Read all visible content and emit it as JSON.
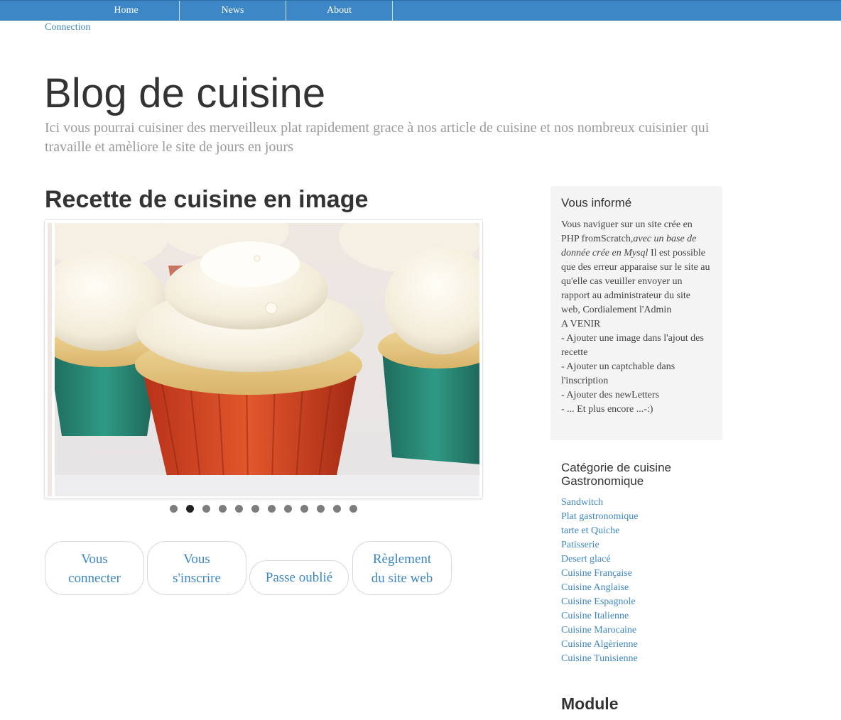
{
  "nav": {
    "home": "Home",
    "news": "News",
    "about": "About",
    "connection": "Connection"
  },
  "header": {
    "title": "Blog de cuisine",
    "subtitle": "Ici vous pourrai cuisiner des merveilleux plat rapidement grace à nos article de cuisine et nos nombreux cuisinier qui travaille et amèliore le site de jours en jours"
  },
  "main": {
    "section_title": "Recette de cuisine en image",
    "carousel": {
      "slide_count": 12,
      "active_index": 1
    },
    "buttons": {
      "login": [
        "Vous",
        "connecter"
      ],
      "register": [
        "Vous",
        "s'inscrire"
      ],
      "forgot": "Passe oublié",
      "rules": [
        "Règlement",
        "du site web"
      ]
    }
  },
  "sidebar": {
    "info": {
      "title": "Vous informé",
      "text_1": "Vous naviguer sur un site crée en PHP fromScratch,",
      "text_italic": "avec un base de donnée crée en Mysql",
      "text_2": " Il est possible que des erreur apparaise sur le site au qu'elle cas veuiller envoyer un rapport au administrateur du site web, Cordialement l'Admin",
      "avenir_title": "A VENIR",
      "avenir_items": [
        "- Ajouter une image dans l'ajout des recette",
        "- Ajouter un captchable dans l'inscription",
        "- Ajouter des newLetters",
        "- ... Et plus encore ...-:)"
      ]
    },
    "categories": {
      "title_line1": "Catégorie de cuisine",
      "title_line2": "Gastronomique",
      "items": [
        "Sandwitch",
        "Plat gastronomique",
        "tarte et Quiche",
        "Patisserie",
        "Desert glacé",
        "Cuisine Française",
        "Cuisine Anglaise",
        "Cuisine Espagnole",
        "Cuisine Italienne",
        "Cuisine Marocaine",
        "Cuisine Algèrienne",
        "Cuisine Tunisienne"
      ]
    },
    "module_title": "Module"
  }
}
